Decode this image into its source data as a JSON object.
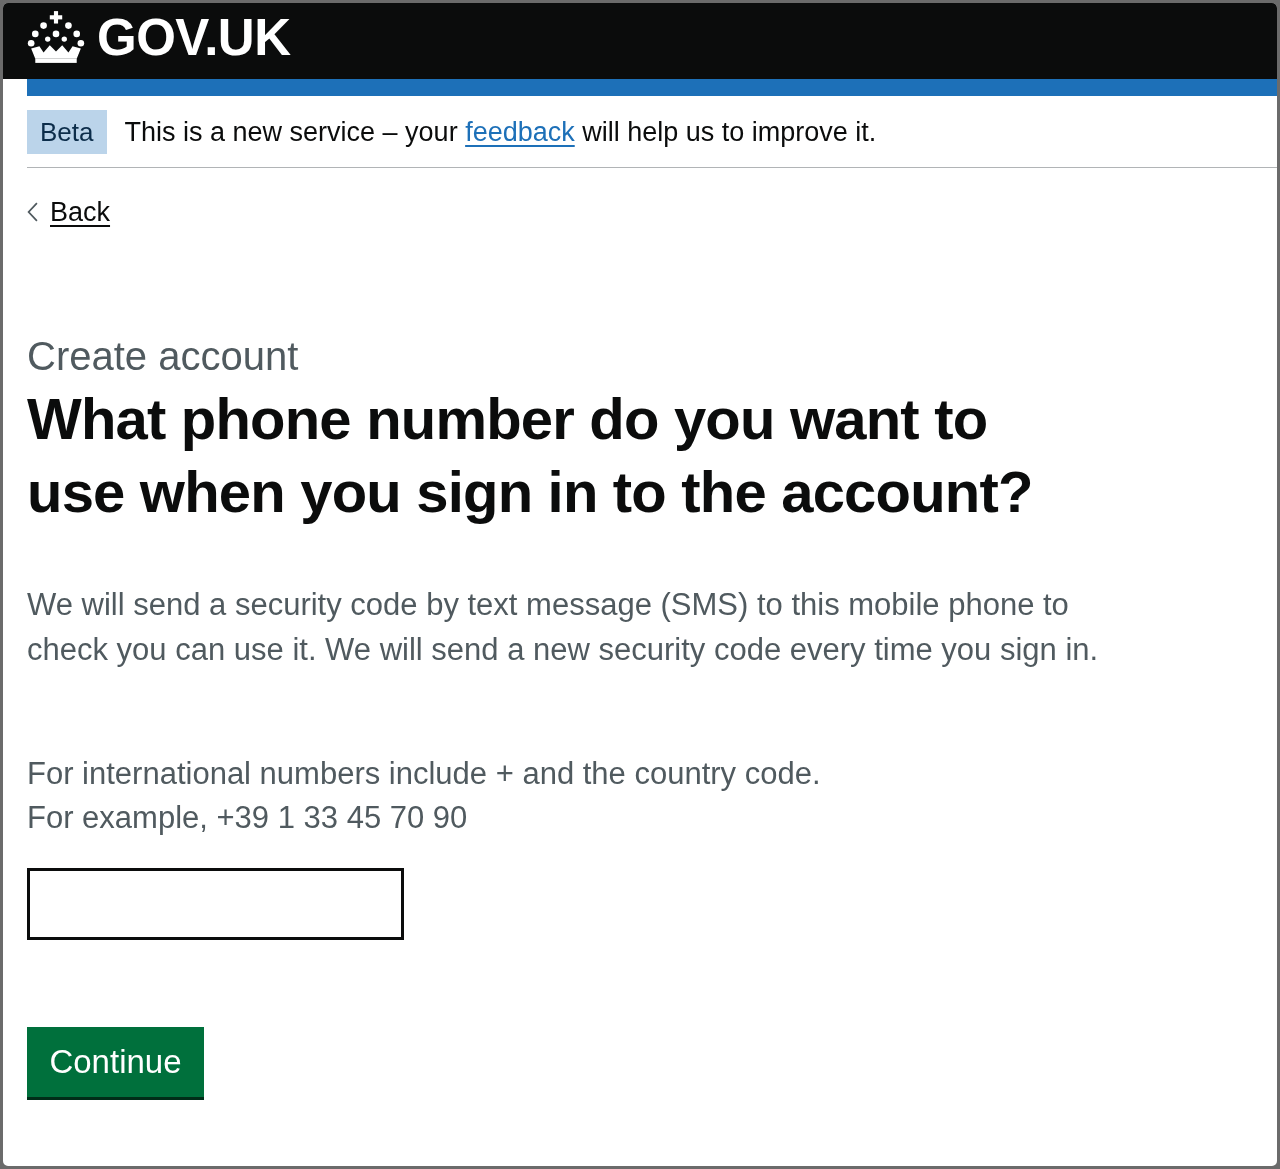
{
  "header": {
    "logo_text": "GOV.UK"
  },
  "phase_banner": {
    "tag": "Beta",
    "text_before": "This is a new service – your ",
    "link": "feedback",
    "text_after": " will help us to improve it."
  },
  "back_link": "Back",
  "caption": "Create account",
  "heading": "What phone number do you want to use when you sign in to the account?",
  "intro": "We will send a security code by text message (SMS) to this mobile phone to check you can use it. We will send a new security code every time you sign in.",
  "hint_lines": [
    "For international numbers include + and the country code.",
    "For example, +39 1 33 45 70 90"
  ],
  "button": "Continue"
}
